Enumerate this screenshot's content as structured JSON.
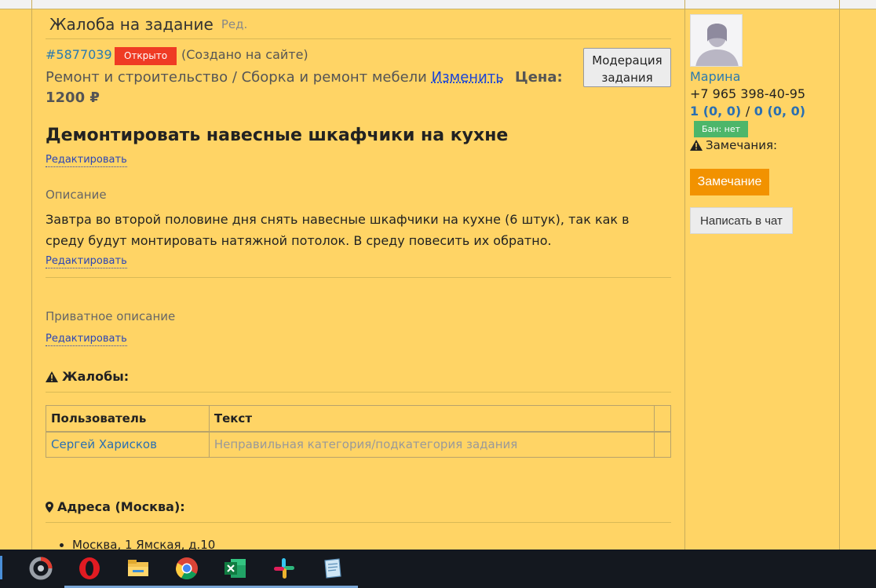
{
  "page": {
    "title": "Жалоба на задание",
    "edit_label": "Ред."
  },
  "task": {
    "id": "#5877039",
    "status": "Открыто",
    "source": "(Создано на сайте)",
    "category": "Ремонт и строительство / Сборка и ремонт мебели",
    "change_label": "Изменить",
    "price_label": "Цена:",
    "price_value": "1200 ₽",
    "moderation_button": "Модерация задания",
    "title": "Демонтировать навесные шкафчики на кухне",
    "edit_link": "Редактировать",
    "description_label": "Описание",
    "description": "Завтра во второй половине дня снять навесные шкафчики на кухне (6 штук), так как в среду будут монтировать натяжной потолок. В среду повесить их обратно.",
    "private_label": "Приватное описание"
  },
  "complaints": {
    "heading": "Жалобы:",
    "columns": [
      "Пользователь",
      "Текст",
      ""
    ],
    "rows": [
      {
        "user": "Сергей Харисков",
        "text": "Неправильная категория/подкатегория задания"
      }
    ]
  },
  "addresses": {
    "heading": "Адреса (Москва):",
    "items": [
      "Москва, 1 Ямская, д.10"
    ]
  },
  "sidebar": {
    "name": "Марина",
    "phone": "+7 965 398-40-95",
    "stat_a": "1 (0, 0)",
    "stat_sep": "/",
    "stat_b": "0 (0, 0)",
    "ban_badge": "Бан: нет",
    "remarks_label": "Замечания:",
    "remark_button": "Замечание",
    "chat_button": "Написать в чат"
  },
  "taskbar": {
    "apps": [
      "photoscape-icon",
      "opera-icon",
      "file-explorer-icon",
      "chrome-icon",
      "excel-icon",
      "slack-icon",
      "notepad-icon"
    ]
  },
  "colors": {
    "background": "#ffd465",
    "status_open": "#ef3b24",
    "ban_badge": "#4db66a",
    "remark_button": "#f29200",
    "link": "#2a7ab0"
  }
}
